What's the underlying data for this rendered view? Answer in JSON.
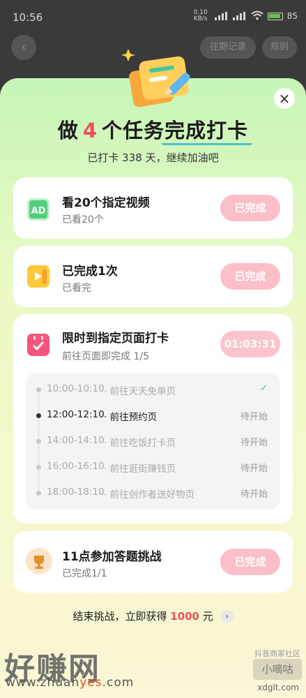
{
  "status_bar": {
    "time": "10:56",
    "network_speed": "0.10 KB/s",
    "battery": "85"
  },
  "background": {
    "back_label": "‹",
    "record_label": "往期记录",
    "rules_label": "规则"
  },
  "header": {
    "title_prefix": "做",
    "title_count": "4",
    "title_mid": "个任务",
    "title_highlight": "完成打卡",
    "subtitle": "已打卡 338 天，继续加油吧",
    "close_label": "×"
  },
  "tasks": [
    {
      "title": "看20个指定视频",
      "sub": "已看20个",
      "button": "已完成",
      "icon": "ad-video-icon",
      "icon_label": "AD"
    },
    {
      "title": "已完成1次",
      "sub": "已看完",
      "button": "已完成",
      "icon": "play-icon"
    },
    {
      "title": "限时到指定页面打卡",
      "sub": "前往页面即完成 1/5",
      "button": "01:03:31",
      "icon": "calendar-check-icon",
      "slots": [
        {
          "time": "10:00-10:10",
          "sep": "·",
          "desc": "前往天天免单页",
          "state": "✓",
          "status": "done"
        },
        {
          "time": "12:00-12:10",
          "sep": "·",
          "desc": "前往预约页",
          "state": "待开始",
          "status": "active"
        },
        {
          "time": "14:00-14:10",
          "sep": "·",
          "desc": "前往吃饭打卡页",
          "state": "待开始",
          "status": "pending"
        },
        {
          "time": "16:00-16:10",
          "sep": "·",
          "desc": "前往逛街赚钱页",
          "state": "待开始",
          "status": "pending"
        },
        {
          "time": "18:00-18:10",
          "sep": "·",
          "desc": "前往创作者送好物页",
          "state": "待开始",
          "status": "pending"
        }
      ]
    },
    {
      "title": "11点参加答题挑战",
      "sub": "已完成1/1",
      "button": "已完成",
      "icon": "trophy-icon"
    }
  ],
  "footer": {
    "text": "结束挑战，立即获得",
    "reward": "1000",
    "unit": "元",
    "chevron": "›"
  },
  "watermark": {
    "left_logo": "好赚网",
    "url_prefix": "www.zhuan",
    "url_highlight": "yes",
    "url_suffix": ".com",
    "right_top": "抖音商家社区",
    "right_logo": "小嘀咕",
    "right_url": "xdglt.com"
  },
  "colors": {
    "accent_red": "#f24e5a",
    "done_button": "#fbbfc7",
    "check_green": "#52c46a"
  }
}
